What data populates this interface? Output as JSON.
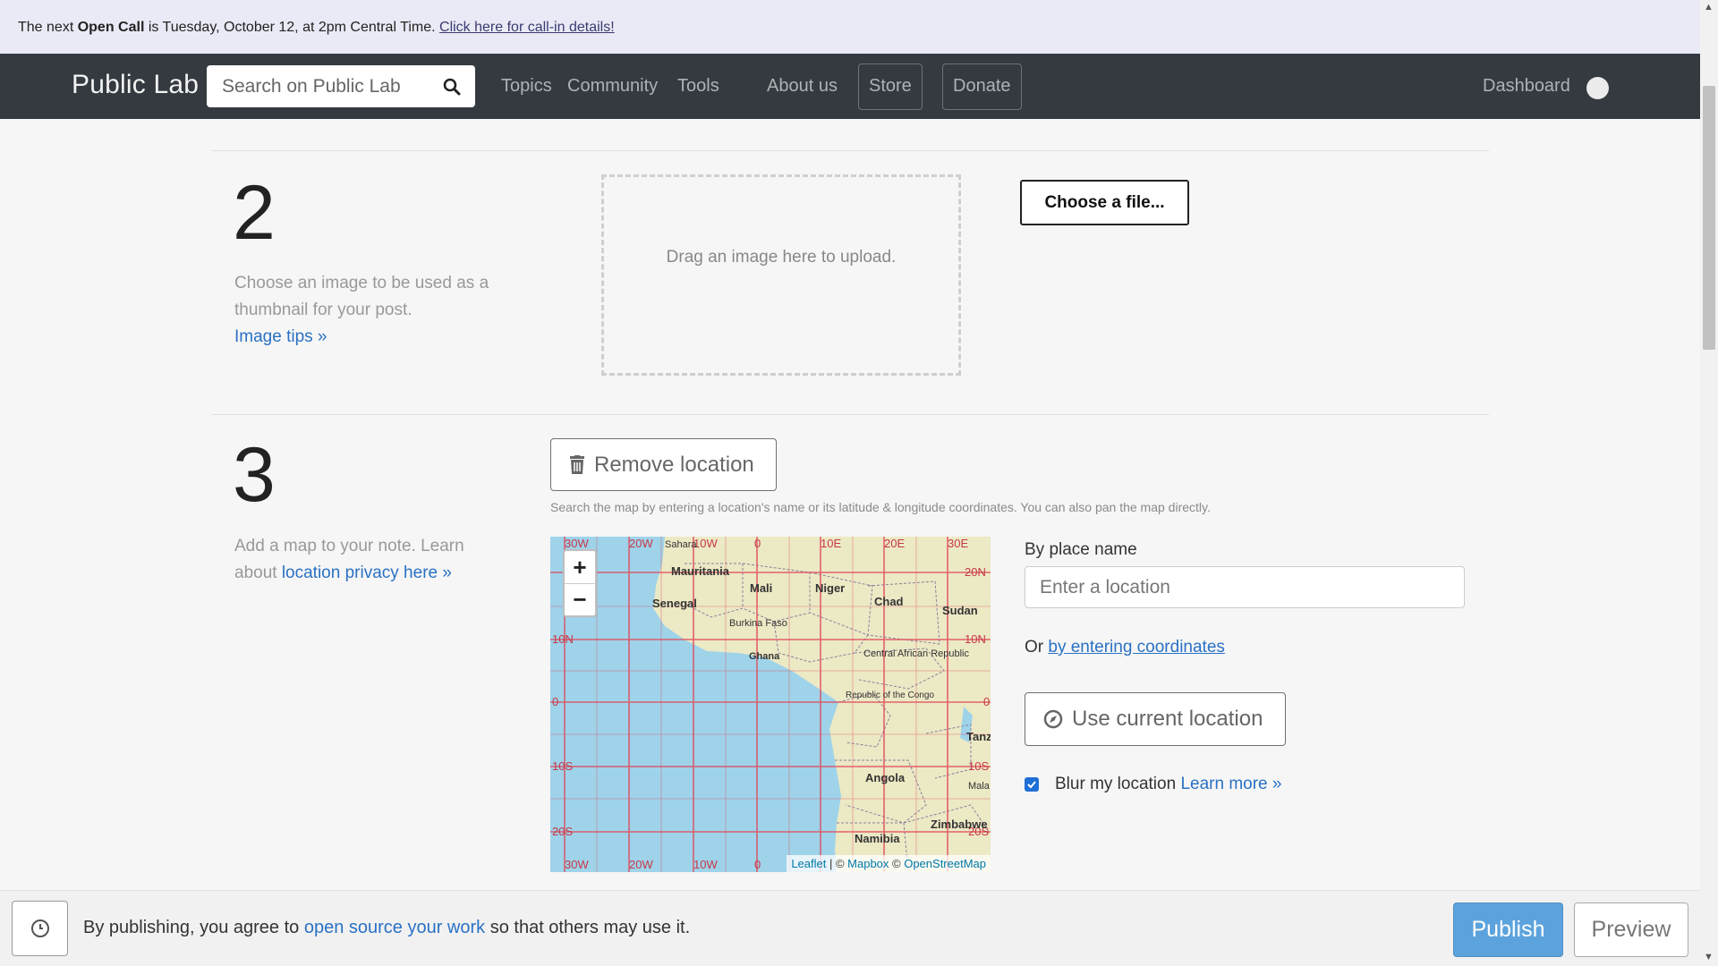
{
  "announcement": {
    "prefix": "The next ",
    "bold": "Open Call",
    "text": " is Tuesday, October 12, at 2pm Central Time. ",
    "link": "Click here for call-in details!"
  },
  "navbar": {
    "brand": "Public Lab",
    "search_placeholder": "Search on Public Lab",
    "links": [
      "Topics",
      "Community",
      "Tools",
      "About us"
    ],
    "store": "Store",
    "donate": "Donate",
    "dashboard": "Dashboard"
  },
  "step2": {
    "number": "2",
    "description": "Choose an image to be used as a thumbnail for your post.",
    "link": "Image tips »",
    "dropzone": "Drag an image here to upload.",
    "choose_button": "Choose a file..."
  },
  "step3": {
    "number": "3",
    "description": "Add a map to your note. Learn about ",
    "link": "location privacy here »",
    "remove_button": "Remove location",
    "hint": "Search the map by entering a location's name or its latitude & longitude coordinates. You can also pan the map directly.",
    "by_place_label": "By place name",
    "location_placeholder": "Enter a location",
    "or_text": "Or ",
    "coords_link": "by entering coordinates",
    "current_location_button": "Use current location",
    "blur_label": "Blur my location ",
    "blur_checked": true,
    "learn_more": "Learn more »"
  },
  "map": {
    "zoom_in": "+",
    "zoom_out": "−",
    "grid_top": [
      "30W",
      "20W",
      "10W",
      "0",
      "10E",
      "20E",
      "30E"
    ],
    "grid_bottom": [
      "30W",
      "20W",
      "10W",
      "0"
    ],
    "grid_left": [
      "10N",
      "0",
      "10S",
      "20S"
    ],
    "grid_right": [
      "20N",
      "10N",
      "0",
      "10S",
      "20S"
    ],
    "places": [
      "Sahara",
      "Mauritania",
      "Mali",
      "Niger",
      "Senegal",
      "Chad",
      "Sudan",
      "Burkina Faso",
      "Ghana",
      "Central African Republic",
      "Republic of the Congo",
      "Tanz",
      "Angola",
      "Mala",
      "Namibia",
      "Zimbabwe"
    ],
    "attribution": [
      "Leaflet",
      "Mapbox",
      "OpenStreetMap"
    ],
    "colors": {
      "ocean": "#9ed3ea",
      "land": "#ece9c5",
      "grid": "#e04a5a"
    }
  },
  "footer": {
    "agree_prefix": "By publishing, you agree to ",
    "agree_link": "open source your work",
    "agree_suffix": " so that others may use it.",
    "publish": "Publish",
    "preview": "Preview"
  }
}
